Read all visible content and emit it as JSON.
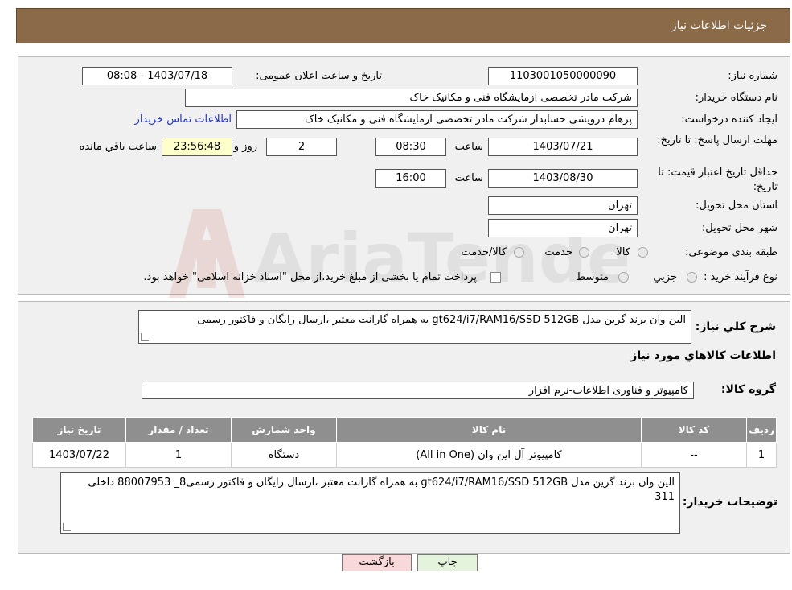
{
  "header": {
    "title": "جزئیات اطلاعات نیاز"
  },
  "form": {
    "need_number_label": "شماره نیاز:",
    "need_number": "1103001050000090",
    "announce_label": "تاریخ و ساعت اعلان عمومی:",
    "announce_value": "1403/07/18 - 08:08",
    "buyer_label": "نام دستگاه خریدار:",
    "buyer_value": "شرکت مادر تخصصی ازمایشگاه فنی و مکانیک خاک",
    "creator_label": "ایجاد کننده درخواست:",
    "creator_value": "پرهام درویشی حسابدار شرکت مادر تخصصی ازمایشگاه فنی و مکانیک خاک",
    "contact_link": "اطلاعات تماس خریدار",
    "deadline_label": "مهلت ارسال پاسخ: تا تاریخ:",
    "deadline_date": "1403/07/21",
    "time_label": "ساعت",
    "deadline_time": "08:30",
    "days_value": "2",
    "days_label": "روز و",
    "remaining_value": "23:56:48",
    "remaining_label": "ساعت باقي مانده",
    "validity_label": "حداقل تاریخ اعتبار قیمت: تا تاریخ:",
    "validity_date": "1403/08/30",
    "validity_time": "16:00",
    "province_label": "استان محل تحویل:",
    "province_value": "تهران",
    "city_label": "شهر محل تحویل:",
    "city_value": "تهران",
    "category_label": "طبقه بندی موضوعی:",
    "category_options": [
      "کالا",
      "خدمت",
      "کالا/خدمت"
    ],
    "process_label": "نوع فرآیند خرید :",
    "process_options": [
      "جزیي",
      "متوسط"
    ],
    "payment_note": "پرداخت تمام یا بخشی از مبلغ خرید،از محل \"اسناد خزانه اسلامی\" خواهد بود."
  },
  "description": {
    "label": "شرح کلي نیاز:",
    "value": "الین وان برند گرین مدل  gt624/i7/RAM16/SSD 512GB به همراه گارانت معتبر ،ارسال رایگان و فاکتور رسمی"
  },
  "goods_section": {
    "title": "اطلاعات کالاهاي مورد نیاز",
    "group_label": "گروه کالا:",
    "group_value": "کامپیوتر و فناوری اطلاعات-نرم افزار"
  },
  "table": {
    "headers": [
      "ردیف",
      "کد کالا",
      "نام کالا",
      "واحد شمارش",
      "تعداد / مقدار",
      "تاریخ نیاز"
    ],
    "rows": [
      [
        "1",
        "--",
        "کامپیوتر آل این وان (All in One)",
        "دستگاه",
        "1",
        "1403/07/22"
      ]
    ]
  },
  "buyer_notes": {
    "label": "توضیحات خریدار:",
    "value": "الین وان برند گرین مدل  gt624/i7/RAM16/SSD 512GB به همراه گارانت معتبر ،ارسال رایگان و فاکتور رسمی8_ 88007953 داخلی 311"
  },
  "buttons": {
    "print": "چاپ",
    "back": "بازگشت"
  },
  "watermark": {
    "text": "AriaTender.neT"
  },
  "colors": {
    "header_bg": "#8b6a47",
    "panel_bg": "#f0f0f0",
    "table_header": "#8f8f8f",
    "remaining_bg": "#ffffcc",
    "back_btn": "#f8d8d8",
    "print_btn": "#e4f4dc",
    "link": "#2233cc"
  }
}
